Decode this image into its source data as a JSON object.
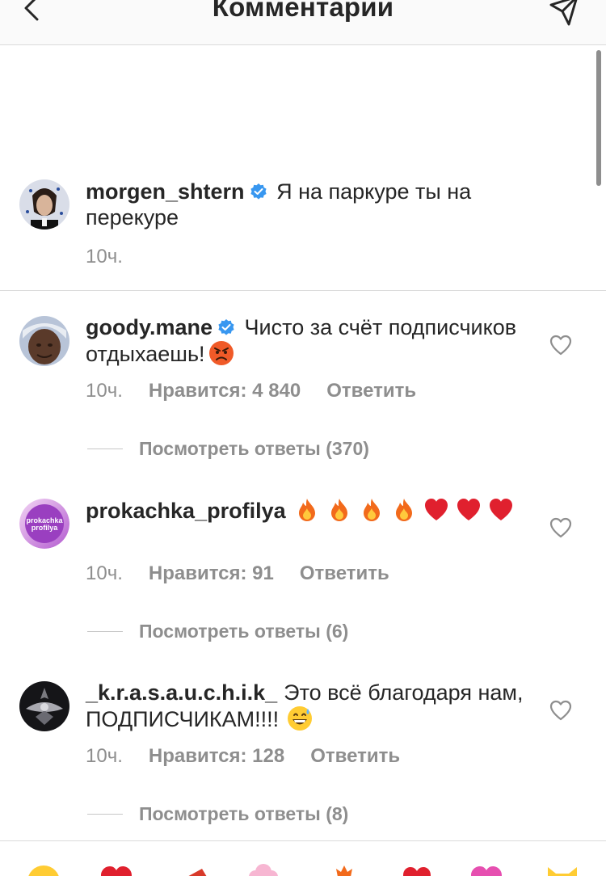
{
  "header": {
    "title": "Комментарии"
  },
  "caption": {
    "username": "morgen_shtern",
    "text": "Я на паркуре ты на перекуре",
    "time": "10ч."
  },
  "comments": [
    {
      "username": "goody.mane",
      "text": "Чисто за счёт подписчиков отдыхаешь!",
      "time": "10ч.",
      "likes": "Нравится: 4 840",
      "reply": "Ответить",
      "view_replies": "Посмотреть ответы (370)"
    },
    {
      "username": "prokachka_profilya",
      "avatar_text": [
        "prokachka",
        "profilya"
      ],
      "text": "",
      "time": "10ч.",
      "likes": "Нравится: 91",
      "reply": "Ответить",
      "view_replies": "Посмотреть ответы (6)"
    },
    {
      "username": "_k.r.a.s.a.u.c.h.i.k_",
      "text": "Это всё благодаря нам, ПОДПИСЧИКАМ!!!!",
      "time": "10ч.",
      "likes": "Нравится: 128",
      "reply": "Ответить",
      "view_replies": "Посмотреть ответы (8)"
    }
  ],
  "icons": {
    "verified_color": "#3897f0",
    "heart_outline_color": "#8e8e8e",
    "secondary_text_color": "#8e8e8e"
  }
}
